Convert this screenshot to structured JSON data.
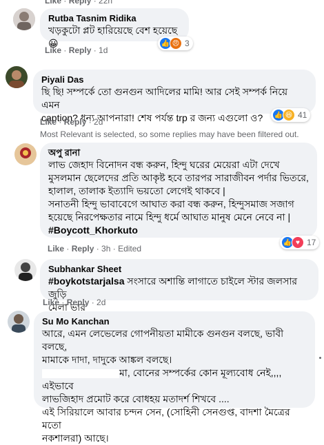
{
  "comments": [
    {
      "name": "Rutba Tasnim Ridika",
      "text": "খড়কুটো প্লট হারিয়েছে বেশ হয়েছে😀",
      "like": "Like",
      "reply": "Reply",
      "time": "1d",
      "reactions": "3",
      "react_icons": [
        "like-icon",
        "angry-icon"
      ]
    },
    {
      "name": "Piyali Das",
      "line1": "ছি ছি! সম্পর্কে তো গুনগুন আদিলের মামি! আর সেই সম্পর্ক নিয়ে এমন",
      "line2": "caption? ধন্য আপনারা! শেষ পর্যন্ত trp র জন্য এগুলো ও?",
      "like": "Like",
      "reply": "Reply",
      "time": "2d",
      "reactions": "41",
      "react_icons": [
        "like-icon",
        "haha-icon"
      ]
    },
    {
      "name": "অপু রানা",
      "lines": [
        "লাভ জেহাদ বিনোদন বন্ধ করুন, হিন্দু ঘরের মেয়েরা এটা দেখে",
        "মুসলমান ছেলেদের প্রতি আকৃষ্ট হবে তারপর সারাজীবন পর্দার ভিতরে,",
        "হালাল, তালাক ইত্যাদি ভয়তো লেগেই থাকবে |",
        "সনাতনী হিন্দু ভাবাবেগে আঘাত করা বন্ধ করুন, হিন্দুসমাজ সজাগ",
        "হয়েছে নিরপেক্ষতার নামে হিন্দু ধর্মে আঘাত মানুষ মেনে নেবে না |"
      ],
      "hashtag": "#Boycott_Khorkuto",
      "like": "Like",
      "reply": "Reply",
      "time": "3h",
      "edited": "Edited",
      "reactions": "17",
      "react_icons": [
        "like-icon",
        "love-icon"
      ]
    },
    {
      "name": "Subhankar Sheet",
      "hashtag": "#boykotstarjalsa",
      "line1": " সংসারে অশান্তি লাগাতে চাইলে স্টার জলসার জুড়ি",
      "line2": "মেলা ভার",
      "like": "Like",
      "reply": "Reply",
      "time": "2d"
    },
    {
      "name": "Su Mo Kanchan",
      "lines": [
        "আরে, এমন লেভেলের গোপনীয়তা মামীকে গুনগুন বলছে, ভাবী বলছে,",
        "মামাকে দাদা, দাদুকে আঙ্কল বলছে।",
        "মা, বোনের সম্পর্কের কোন মূল্যবোধ নেই,,,, এইভাবে",
        "লাভজিহাদ প্রমোট করে বোধহয় মতাদর্শ শিখবে ....",
        "এই সিরিয়ালে আবার চন্দন সেন, (সোহিনী সেনগুপ্ত, বাদশা মৈত্রের মতো",
        "নকশালরা) আছে।"
      ]
    }
  ],
  "top_actions": {
    "like": "Like",
    "reply": "Reply",
    "time": "22h"
  },
  "filter_note": "Most Relevant is selected, so some replies may have been filtered out."
}
